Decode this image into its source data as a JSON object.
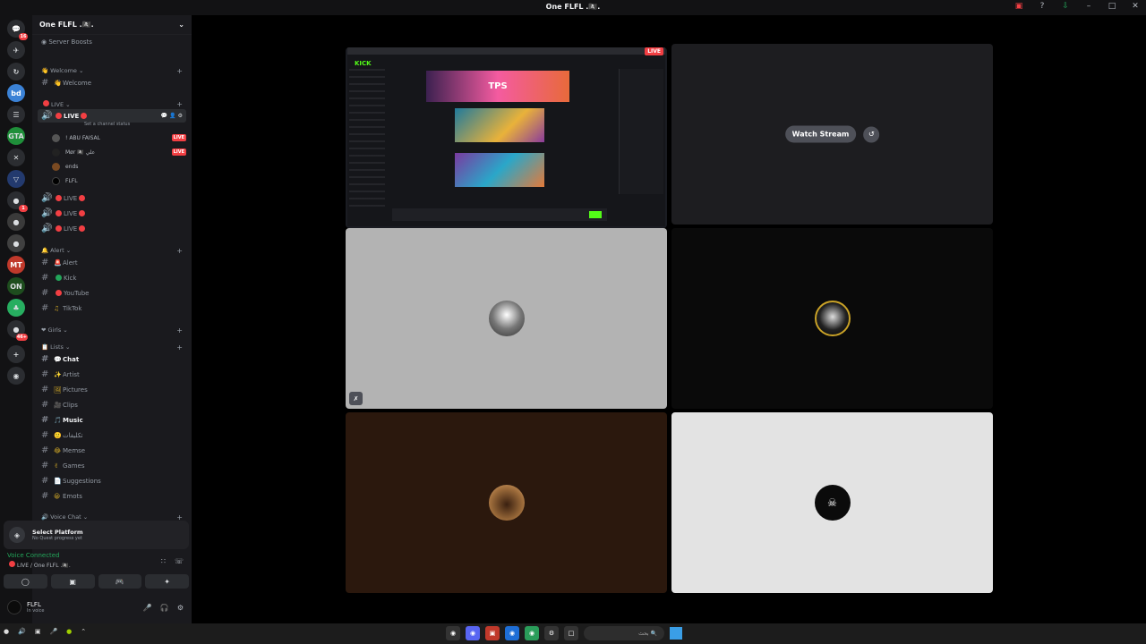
{
  "window": {
    "title": "One FLFL .🏴‍☠️.",
    "controls": [
      "screen-share-icon",
      "help-icon",
      "download-icon",
      "minimize",
      "maximize",
      "close"
    ]
  },
  "guilds": [
    {
      "label": "💬",
      "badge": "16"
    },
    {
      "label": "✈"
    },
    {
      "label": "↻"
    },
    {
      "label": "bd"
    },
    {
      "label": "☰"
    },
    {
      "label": "GTA"
    },
    {
      "label": "✕"
    },
    {
      "label": "▽"
    },
    {
      "label": "●",
      "badge": "1"
    },
    {
      "label": "●"
    },
    {
      "label": "●"
    },
    {
      "label": "MT"
    },
    {
      "label": "ON"
    },
    {
      "label": "♣"
    },
    {
      "label": "●",
      "badge": "46+"
    },
    {
      "label": "+"
    },
    {
      "label": "◉"
    }
  ],
  "server": {
    "name": "One FLFL .🏴‍☠️.",
    "boosts_label": "Server Boosts"
  },
  "categories": {
    "welcome": "Welcome",
    "live": "LIVE",
    "alert": "Alert",
    "girls": "Girls",
    "lists": "Lists",
    "voice": "Voice Chat"
  },
  "channels": {
    "welcome": "Welcome",
    "live_active": "LIVE",
    "live_status": "Set a channel status",
    "live_2": "LIVE",
    "live_3": "LIVE",
    "live_4": "LIVE",
    "alert": "Alert",
    "kick": "Kick",
    "youtube": "YouTube",
    "tiktok": "TikTok",
    "chat": "Chat",
    "artist": "Artist",
    "pictures": "Pictures",
    "clips": "Clips",
    "music": "Music",
    "arabic": "تكليفات",
    "memes": "Memse",
    "games": "Games",
    "suggestions": "Suggestions",
    "emots": "Emots"
  },
  "voice_users": [
    {
      "name": "! ABU FAISAL",
      "live": "LIVE"
    },
    {
      "name": "Mør 🏴‍☠️ علي",
      "live": "LIVE"
    },
    {
      "name": "ends"
    },
    {
      "name": "FLFL"
    }
  ],
  "quest": {
    "title": "Select Platform",
    "subtitle": "No Quest progress yet"
  },
  "voice_connection": {
    "status": "Voice Connected",
    "channel": "LIVE / One FLFL .🏴‍☠️."
  },
  "user": {
    "name": "FLFL",
    "status": "In voice"
  },
  "stage": {
    "watch_label": "Watch Stream",
    "live_label": "LIVE",
    "stream_preview": {
      "site": "KICK",
      "banner": "TPS"
    },
    "skull_icon": "☠"
  },
  "taskbar": {
    "search_placeholder": "بحث"
  },
  "colors": {
    "live_red": "#f23f43",
    "voice_green": "#23a55a",
    "kick_green": "#53fc18"
  }
}
